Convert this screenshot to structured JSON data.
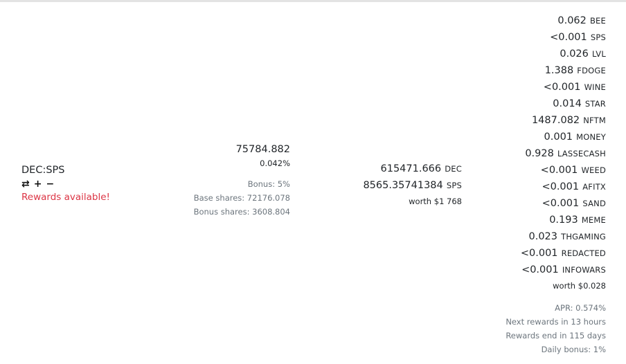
{
  "pair": {
    "name": "DEC:SPS",
    "actions": {
      "swap": "⇄",
      "add": "+",
      "remove": "−"
    },
    "rewards_label": "Rewards available!"
  },
  "shares": {
    "total": "75784.882",
    "percent": "0.042%",
    "bonus": "Bonus: 5%",
    "base": "Base shares: 72176.078",
    "bonus_shares": "Bonus shares: 3608.804"
  },
  "liquidity": {
    "tokens": [
      {
        "amount": "615471.666",
        "symbol": "DEC"
      },
      {
        "amount": "8565.35741384",
        "symbol": "SPS"
      }
    ],
    "worth": "worth $1 768"
  },
  "rewards": {
    "tokens": [
      {
        "amount": "0.062",
        "symbol": "BEE"
      },
      {
        "amount": "<0.001",
        "symbol": "SPS"
      },
      {
        "amount": "0.026",
        "symbol": "LVL"
      },
      {
        "amount": "1.388",
        "symbol": "FDOGE"
      },
      {
        "amount": "<0.001",
        "symbol": "WINE"
      },
      {
        "amount": "0.014",
        "symbol": "STAR"
      },
      {
        "amount": "1487.082",
        "symbol": "NFTM"
      },
      {
        "amount": "0.001",
        "symbol": "MONEY"
      },
      {
        "amount": "0.928",
        "symbol": "LASSECASH"
      },
      {
        "amount": "<0.001",
        "symbol": "WEED"
      },
      {
        "amount": "<0.001",
        "symbol": "AFITX"
      },
      {
        "amount": "<0.001",
        "symbol": "SAND"
      },
      {
        "amount": "0.193",
        "symbol": "MEME"
      },
      {
        "amount": "0.023",
        "symbol": "THGAMING"
      },
      {
        "amount": "<0.001",
        "symbol": "REDACTED"
      },
      {
        "amount": "<0.001",
        "symbol": "INFOWARS"
      }
    ],
    "worth": "worth $0.028",
    "apr": "APR: 0.574%",
    "next_rewards": "Next rewards in 13 hours",
    "rewards_end": "Rewards end in 115 days",
    "daily_bonus": "Daily bonus: 1%"
  },
  "colors": {
    "rewards": "#dc3545",
    "muted": "#6c757d",
    "text": "#212529"
  }
}
